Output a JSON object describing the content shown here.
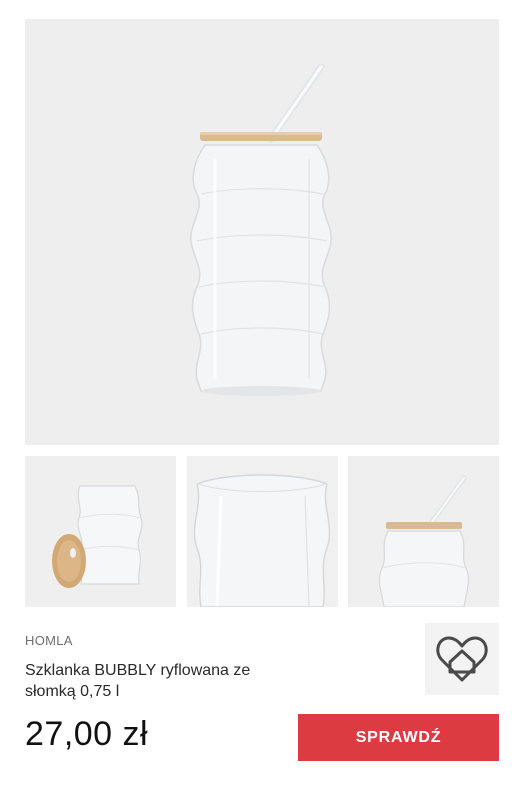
{
  "product": {
    "brand": "HOMLA",
    "title": "Szklanka BUBBLY ryflowana ze słomką 0,75 l",
    "price": "27,00 zł",
    "cta_label": "SPRAWDŹ"
  },
  "gallery": {
    "main_image": "glass-jar-with-bamboo-lid-and-straw",
    "thumbnails": [
      "glass-jar-with-lid-leaning",
      "glass-jar-closeup",
      "glass-jar-lid-and-straw-top"
    ]
  },
  "colors": {
    "accent": "#dc3c41",
    "image_bg": "#eeeeef"
  },
  "icons": {
    "store_logo": "heart-house-logo-icon"
  }
}
